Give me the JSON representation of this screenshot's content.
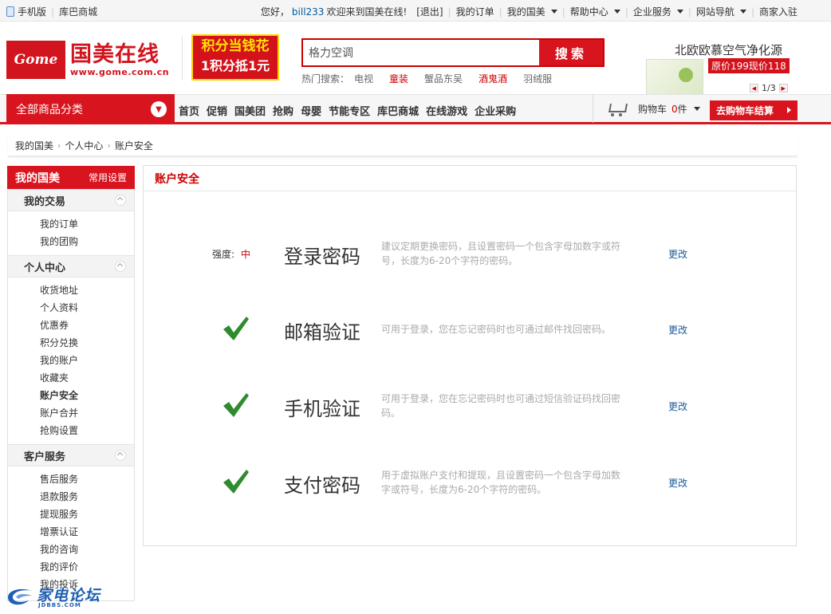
{
  "topbar": {
    "mobile": "手机版",
    "kuba": "库巴商城",
    "greeting": "您好，",
    "username": "bill233",
    "welcome": "欢迎来到国美在线!",
    "logout": "[退出]",
    "links": [
      "我的订单",
      "我的国美",
      "帮助中心",
      "企业服务",
      "网站导航",
      "商家入驻"
    ]
  },
  "logo": {
    "badge": "Gome",
    "name": "国美在线",
    "url": "www.gome.com.cn"
  },
  "promo": {
    "line1": "积分当钱花",
    "line2": "1积分抵1元"
  },
  "search": {
    "value": "格力空调",
    "button": "搜索",
    "hot_label": "热门搜索：",
    "hot": [
      {
        "text": "电视",
        "red": false
      },
      {
        "text": "童装",
        "red": true
      },
      {
        "text": "蟹品东吴",
        "red": false
      },
      {
        "text": "酒鬼酒",
        "red": true
      },
      {
        "text": "羽绒服",
        "red": false
      }
    ]
  },
  "ad": {
    "title": "北欧欧慕空气净化源",
    "price": "原价199现价118",
    "page": "1/3"
  },
  "nav": {
    "category": "全部商品分类",
    "items": [
      "首页",
      "促销",
      "国美团",
      "抢购",
      "母婴",
      "节能专区",
      "库巴商城",
      "在线游戏",
      "企业采购"
    ],
    "cart_label": "购物车",
    "cart_count": "0",
    "cart_unit": "件",
    "checkout": "去购物车结算"
  },
  "breadcrumb": [
    "我的国美",
    "个人中心",
    "账户安全"
  ],
  "sidebar": {
    "title": "我的国美",
    "settings": "常用设置",
    "groups": [
      {
        "title": "我的交易",
        "items": [
          "我的订单",
          "我的团购"
        ]
      },
      {
        "title": "个人中心",
        "items": [
          "收货地址",
          "个人资料",
          "优惠券",
          "积分兑换",
          "我的账户",
          "收藏夹",
          "账户安全",
          "账户合并",
          "抢购设置"
        ]
      },
      {
        "title": "客户服务",
        "items": [
          "售后服务",
          "退款服务",
          "提现服务",
          "增票认证",
          "我的咨询",
          "我的评价",
          "我的投诉"
        ]
      }
    ],
    "current": "账户安全"
  },
  "panel": {
    "title": "账户安全",
    "change_label": "更改",
    "strength_label": "强度:",
    "strength_value": "中",
    "rows": [
      {
        "name": "登录密码",
        "desc": "建议定期更换密码，且设置密码一个包含字母加数字或符号，长度为6-20个字符的密码。",
        "status": "strength"
      },
      {
        "name": "邮箱验证",
        "desc": "可用于登录，您在忘记密码时也可通过邮件找回密码。",
        "status": "check"
      },
      {
        "name": "手机验证",
        "desc": "可用于登录，您在忘记密码时也可通过短信验证码找回密码。",
        "status": "check"
      },
      {
        "name": "支付密码",
        "desc": "用于虚拟账户支付和提现，且设置密码一个包含字母加数字或符号，长度为6-20个字符的密码。",
        "status": "check"
      }
    ]
  },
  "watermark": {
    "title": "家电论坛",
    "sub": "JDBBS.COM"
  },
  "colors": {
    "brand_red": "#d8141e",
    "link_blue": "#1a5a9a",
    "check_green": "#2e8b2e"
  }
}
